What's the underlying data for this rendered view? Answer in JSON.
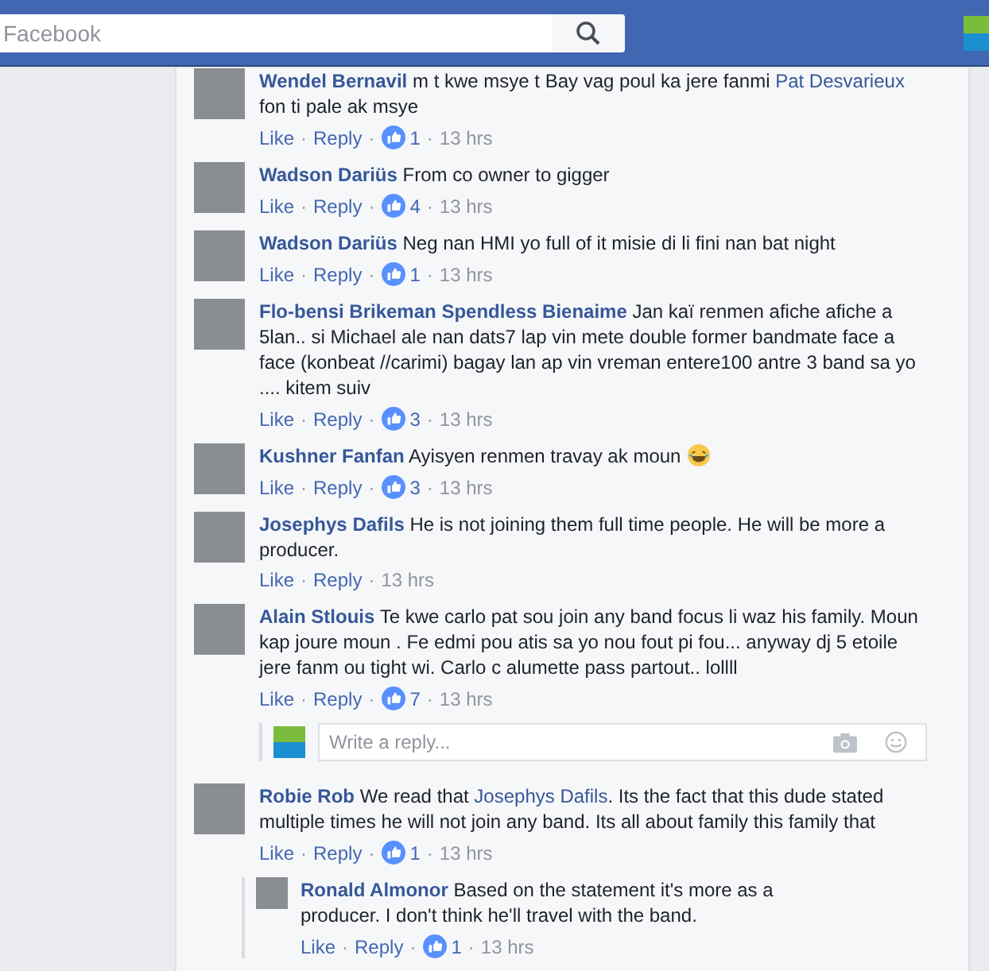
{
  "header": {
    "search": {
      "placeholder": "Facebook"
    }
  },
  "comments": [
    {
      "author": "Wendel Bernavil",
      "body": [
        {
          "kind": "text",
          "text": "m t kwe msye t Bay vag poul ka jere fanmi "
        },
        {
          "kind": "link",
          "text": "Pat Desvarieux"
        },
        {
          "kind": "text",
          "text": " fon ti pale ak msye"
        }
      ],
      "actions": [
        {
          "kind": "link",
          "text": "Like"
        },
        {
          "kind": "sep",
          "text": "·"
        },
        {
          "kind": "link",
          "text": "Reply"
        },
        {
          "kind": "sep",
          "text": "·"
        },
        {
          "kind": "likes",
          "text": "1"
        },
        {
          "kind": "sep",
          "text": "·"
        },
        {
          "kind": "time",
          "text": "13 hrs"
        }
      ]
    },
    {
      "author": "Wadson Dariüs",
      "body": [
        {
          "kind": "text",
          "text": "From co owner to gigger"
        }
      ],
      "actions": [
        {
          "kind": "link",
          "text": "Like"
        },
        {
          "kind": "sep",
          "text": "·"
        },
        {
          "kind": "link",
          "text": "Reply"
        },
        {
          "kind": "sep",
          "text": "·"
        },
        {
          "kind": "likes",
          "text": "4"
        },
        {
          "kind": "sep",
          "text": "·"
        },
        {
          "kind": "time",
          "text": "13 hrs"
        }
      ]
    },
    {
      "author": "Wadson Dariüs",
      "body": [
        {
          "kind": "text",
          "text": "Neg nan HMI yo full of it misie di li fini nan bat night"
        }
      ],
      "actions": [
        {
          "kind": "link",
          "text": "Like"
        },
        {
          "kind": "sep",
          "text": "·"
        },
        {
          "kind": "link",
          "text": "Reply"
        },
        {
          "kind": "sep",
          "text": "·"
        },
        {
          "kind": "likes",
          "text": "1"
        },
        {
          "kind": "sep",
          "text": "·"
        },
        {
          "kind": "time",
          "text": "13 hrs"
        }
      ]
    },
    {
      "author": "Flo-bensi Brikeman Spendless Bienaime",
      "body": [
        {
          "kind": "text",
          "text": "Jan kaï renmen afiche afiche a 5lan.. si Michael ale nan dats7 lap vin mete double former bandmate face a face (konbeat //carimi) bagay lan ap vin vreman entere100 antre 3 band sa yo .... kitem suiv"
        }
      ],
      "actions": [
        {
          "kind": "link",
          "text": "Like"
        },
        {
          "kind": "sep",
          "text": "·"
        },
        {
          "kind": "link",
          "text": "Reply"
        },
        {
          "kind": "sep",
          "text": "·"
        },
        {
          "kind": "likes",
          "text": "3"
        },
        {
          "kind": "sep",
          "text": "·"
        },
        {
          "kind": "time",
          "text": "13 hrs"
        }
      ]
    },
    {
      "author": "Kushner Fanfan",
      "body": [
        {
          "kind": "text",
          "text": "Ayisyen renmen travay ak moun "
        },
        {
          "kind": "emoji"
        }
      ],
      "actions": [
        {
          "kind": "link",
          "text": "Like"
        },
        {
          "kind": "sep",
          "text": "·"
        },
        {
          "kind": "link",
          "text": "Reply"
        },
        {
          "kind": "sep",
          "text": "·"
        },
        {
          "kind": "likes",
          "text": "3"
        },
        {
          "kind": "sep",
          "text": "·"
        },
        {
          "kind": "time",
          "text": "13 hrs"
        }
      ]
    },
    {
      "author": "Josephys Dafils",
      "body": [
        {
          "kind": "text",
          "text": "He is not joining them full time people. He will be more a producer."
        }
      ],
      "actions": [
        {
          "kind": "link",
          "text": "Like"
        },
        {
          "kind": "sep",
          "text": "·"
        },
        {
          "kind": "link",
          "text": "Reply"
        },
        {
          "kind": "sep",
          "text": "·"
        },
        {
          "kind": "time",
          "text": "13 hrs"
        }
      ]
    },
    {
      "author": "Alain Stlouis",
      "body": [
        {
          "kind": "text",
          "text": "Te kwe carlo pat sou join any band focus li waz his family. Moun kap joure moun . Fe edmi pou atis sa yo nou fout pi fou... anyway dj 5 etoile jere fanm ou tight wi. Carlo c alumette pass partout.. lollll"
        }
      ],
      "actions": [
        {
          "kind": "link",
          "text": "Like"
        },
        {
          "kind": "sep",
          "text": "·"
        },
        {
          "kind": "link",
          "text": "Reply"
        },
        {
          "kind": "sep",
          "text": "·"
        },
        {
          "kind": "likes",
          "text": "7"
        },
        {
          "kind": "sep",
          "text": "·"
        },
        {
          "kind": "time",
          "text": "13 hrs"
        }
      ],
      "reply_box": {
        "placeholder": "Write a reply..."
      }
    },
    {
      "author": "Robie Rob",
      "body": [
        {
          "kind": "text",
          "text": "We read that "
        },
        {
          "kind": "link",
          "text": "Josephys Dafils"
        },
        {
          "kind": "text",
          "text": ". Its the fact that this dude stated multiple times he will not join any band. Its all about family this family that"
        }
      ],
      "actions": [
        {
          "kind": "link",
          "text": "Like"
        },
        {
          "kind": "sep",
          "text": "·"
        },
        {
          "kind": "link",
          "text": "Reply"
        },
        {
          "kind": "sep",
          "text": "·"
        },
        {
          "kind": "likes",
          "text": "1"
        },
        {
          "kind": "sep",
          "text": "·"
        },
        {
          "kind": "time",
          "text": "13 hrs"
        }
      ],
      "replies": [
        {
          "author": "Ronald Almonor",
          "body": [
            {
              "kind": "text",
              "text": "Based on the statement it's more as a producer. I don't think he'll travel with the band."
            }
          ],
          "actions": [
            {
              "kind": "link",
              "text": "Like"
            },
            {
              "kind": "sep",
              "text": "·"
            },
            {
              "kind": "link",
              "text": "Reply"
            },
            {
              "kind": "sep",
              "text": "·"
            },
            {
              "kind": "likes",
              "text": "1"
            },
            {
              "kind": "sep",
              "text": "·"
            },
            {
              "kind": "time",
              "text": "13 hrs"
            }
          ]
        }
      ]
    }
  ]
}
